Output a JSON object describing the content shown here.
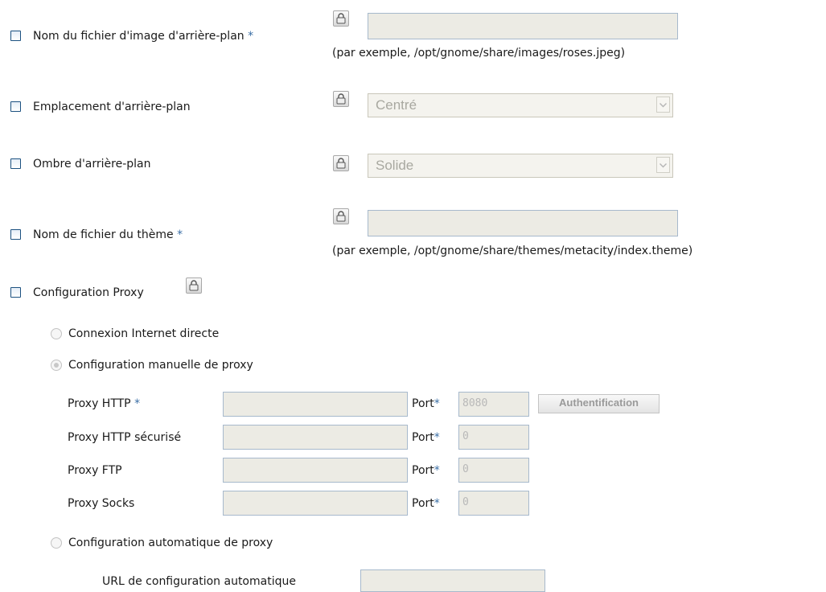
{
  "fields": {
    "background_image": {
      "label": "Nom du fichier d'image d'arrière-plan",
      "required": "*",
      "hint": "(par exemple, /opt/gnome/share/images/roses.jpeg)",
      "value": ""
    },
    "background_placement": {
      "label": "Emplacement d'arrière-plan",
      "selected": "Centré"
    },
    "background_shading": {
      "label": "Ombre d'arrière-plan",
      "selected": "Solide"
    },
    "theme_file": {
      "label": "Nom de fichier du thème",
      "required": "*",
      "hint": "(par exemple, /opt/gnome/share/themes/metacity/index.theme)",
      "value": ""
    }
  },
  "proxy": {
    "label": "Configuration Proxy",
    "options": {
      "direct": "Connexion Internet directe",
      "manual": "Configuration manuelle de proxy",
      "auto": "Configuration automatique de proxy"
    },
    "selected_option": "manual",
    "rows": [
      {
        "label": "Proxy HTTP",
        "required": "*",
        "host": "",
        "port_label": "Port",
        "port_required": "*",
        "port": "8080",
        "button": "Authentification"
      },
      {
        "label": "Proxy HTTP sécurisé",
        "required": "",
        "host": "",
        "port_label": "Port",
        "port_required": "*",
        "port": "0"
      },
      {
        "label": "Proxy FTP",
        "required": "",
        "host": "",
        "port_label": "Port",
        "port_required": "*",
        "port": "0"
      },
      {
        "label": "Proxy Socks",
        "required": "",
        "host": "",
        "port_label": "Port",
        "port_required": "*",
        "port": "0"
      }
    ],
    "auto_url_label": "URL de configuration automatique",
    "auto_url": ""
  },
  "icons": {
    "lock": "lock-icon",
    "dropdown": "chevron-down-icon"
  },
  "colors": {
    "required": "#3a6ea5",
    "checkbox_border": "#1c5180",
    "field_bg": "#ecebe4"
  }
}
